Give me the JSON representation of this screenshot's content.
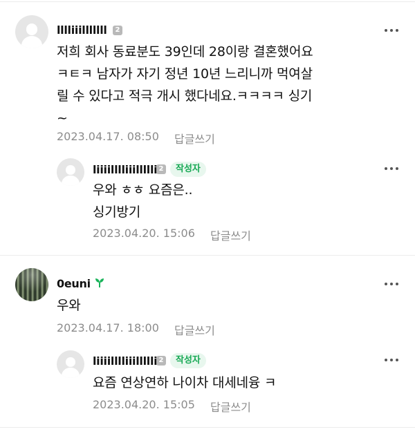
{
  "comments": [
    {
      "nickname": "lllliiilllllll",
      "level": "2",
      "body_lines": [
        "저희 회사 동료분도 39인데 28이랑 결혼했어요",
        "ㅋㅌㅋ 남자가 자기 정년 10년 느리니까 먹여살",
        "릴 수 있다고 적극 개시 했다네요.ㅋㅋㅋㅋ 싱기",
        "~"
      ],
      "date": "2023.04.17. 08:50",
      "reply_label": "답글쓰기",
      "replies": [
        {
          "nickname": "liiiilllliiilllllii",
          "level": "2",
          "badge": "작성자",
          "body_lines": [
            "우와 ㅎㅎ 요즘은..",
            "싱기방기"
          ],
          "date": "2023.04.20. 15:06",
          "reply_label": "답글쓰기"
        }
      ]
    },
    {
      "nickname": "0euni",
      "badge_icon": "sprout-icon",
      "body_lines": [
        "우와"
      ],
      "date": "2023.04.17. 18:00",
      "reply_label": "답글쓰기",
      "replies": [
        {
          "nickname": "liiiilllliiilllllii",
          "level": "2",
          "badge": "작성자",
          "body_lines": [
            "요즘 연상연하 나이차 대세네융 ㅋ"
          ],
          "date": "2023.04.20. 15:05",
          "reply_label": "답글쓰기"
        }
      ]
    }
  ],
  "colors": {
    "author_badge_bg": "#e8f7ee",
    "author_badge_text": "#18a955",
    "meta_text": "#8c8c8c",
    "divider": "#ececec"
  }
}
